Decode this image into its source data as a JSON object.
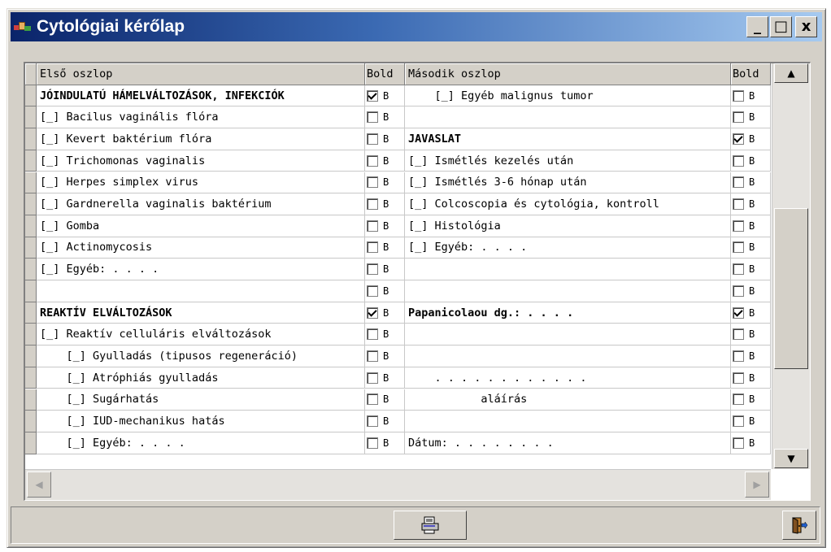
{
  "window": {
    "title": "Cytológiai kérőlap"
  },
  "titlebar_buttons": {
    "minimize": "_",
    "maximize": "□",
    "close": "x"
  },
  "grid": {
    "columns": {
      "first": "Első oszlop",
      "bold1": "Bold",
      "second": "Második oszlop",
      "bold2": "Bold"
    },
    "rows": [
      {
        "c1": "JÓINDULATÚ HÁMELVÁLTOZÁSOK, INFEKCIÓK",
        "b1": true,
        "bold1": true,
        "c3": "    [_] Egyéb malignus tumor",
        "b2": false,
        "bold2": false
      },
      {
        "c1": "[_] Bacilus vaginális flóra",
        "b1": false,
        "bold1": false,
        "c3": "",
        "b2": false,
        "bold2": false
      },
      {
        "c1": "[_] Kevert baktérium flóra",
        "b1": false,
        "bold1": false,
        "c3": "JAVASLAT",
        "b2": true,
        "bold2": true
      },
      {
        "c1": "[_] Trichomonas vaginalis",
        "b1": false,
        "bold1": false,
        "c3": "[_] Ismétlés kezelés után",
        "b2": false,
        "bold2": false
      },
      {
        "c1": "[_] Herpes simplex virus",
        "b1": false,
        "bold1": false,
        "c3": "[_] Ismétlés 3-6 hónap után",
        "b2": false,
        "bold2": false
      },
      {
        "c1": "[_] Gardnerella vaginalis baktérium",
        "b1": false,
        "bold1": false,
        "c3": "[_] Colcoscopia és cytológia, kontroll",
        "b2": false,
        "bold2": false
      },
      {
        "c1": "[_] Gomba",
        "b1": false,
        "bold1": false,
        "c3": "[_] Histológia",
        "b2": false,
        "bold2": false
      },
      {
        "c1": "[_] Actinomycosis",
        "b1": false,
        "bold1": false,
        "c3": "[_] Egyéb: . . . .",
        "b2": false,
        "bold2": false
      },
      {
        "c1": "[_] Egyéb: . . . .",
        "b1": false,
        "bold1": false,
        "c3": "",
        "b2": false,
        "bold2": false
      },
      {
        "c1": "",
        "b1": false,
        "bold1": false,
        "c3": "",
        "b2": false,
        "bold2": false
      },
      {
        "c1": "REAKTÍV ELVÁLTOZÁSOK",
        "b1": true,
        "bold1": true,
        "c3": "Papanicolaou dg.: . . . .",
        "b2": true,
        "bold2": true
      },
      {
        "c1": "[_] Reaktív celluláris elváltozások",
        "b1": false,
        "bold1": false,
        "c3": "",
        "b2": false,
        "bold2": false
      },
      {
        "c1": "    [_] Gyulladás (tipusos regeneráció)",
        "b1": false,
        "bold1": false,
        "c3": "",
        "b2": false,
        "bold2": false
      },
      {
        "c1": "    [_] Atróphiás gyulladás",
        "b1": false,
        "bold1": false,
        "c3": "    . . . . . . . . . . . .",
        "b2": false,
        "bold2": false
      },
      {
        "c1": "    [_] Sugárhatás",
        "b1": false,
        "bold1": false,
        "c3": "           aláírás",
        "b2": false,
        "bold2": false
      },
      {
        "c1": "    [_] IUD-mechanikus hatás",
        "b1": false,
        "bold1": false,
        "c3": "",
        "b2": false,
        "bold2": false
      },
      {
        "c1": "    [_] Egyéb: . . . .",
        "b1": false,
        "bold1": false,
        "c3": "Dátum: . . . . . . . .",
        "b2": false,
        "bold2": false
      }
    ],
    "bold_glyph": "B"
  },
  "icons": {
    "scroll_up": "up-arrow-icon",
    "scroll_down": "down-arrow-icon",
    "scroll_left": "left-arrow-icon",
    "scroll_right": "right-arrow-icon",
    "print": "print-icon",
    "exit": "exit-door-icon"
  },
  "colors": {
    "title_start": "#0a246a",
    "title_end": "#a6caf0",
    "face": "#d4d0c8"
  }
}
